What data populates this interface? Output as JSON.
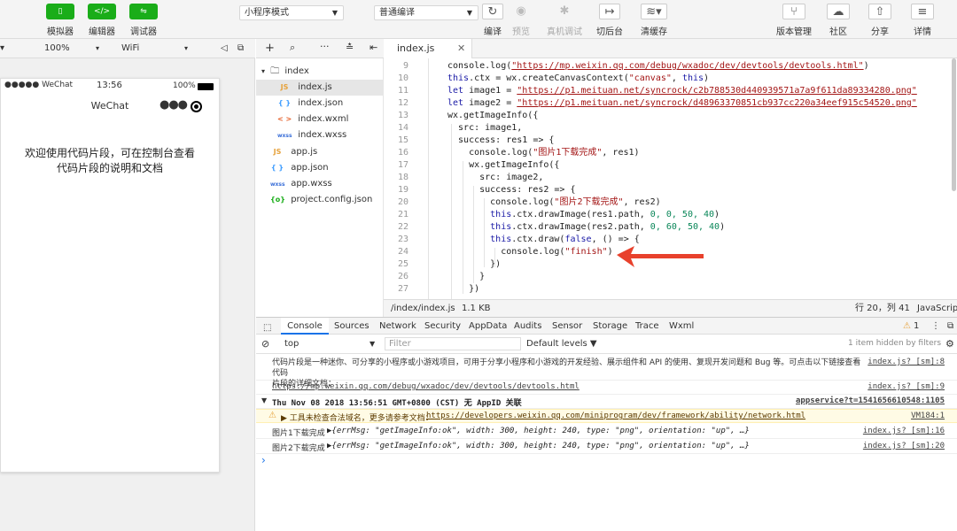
{
  "toolbar": {
    "simulator": "模拟器",
    "editor": "编辑器",
    "debugger": "调试器",
    "mode": "小程序模式",
    "compile": "普通编译",
    "build": "编译",
    "preview": "预览",
    "remote_debug": "真机调试",
    "cut_bg": "切后台",
    "clear_cache": "清缓存",
    "version": "版本管理",
    "community": "社区",
    "share": "分享",
    "details": "详情"
  },
  "devicebar": {
    "zoom": "100%",
    "network": "WiFi"
  },
  "phone": {
    "carrier": "●●●●● WeChat",
    "time": "13:56",
    "battery": "100%",
    "title": "WeChat",
    "text_line1": "欢迎使用代码片段，可在控制台查看",
    "text_line2": "代码片段的说明和文档"
  },
  "tree": {
    "items": [
      "index",
      "index.js",
      "index.json",
      "index.wxml",
      "index.wxss",
      "app.js",
      "app.json",
      "app.wxss",
      "project.config.json"
    ],
    "icons": [
      "▾",
      "JS",
      "{ }",
      "< >",
      "wxss",
      "JS",
      "{ }",
      "wxss",
      "{o}"
    ]
  },
  "editor": {
    "tab": "index.js",
    "line_numbers": [
      "9",
      "10",
      "11",
      "12",
      "13",
      "14",
      "15",
      "16",
      "17",
      "18",
      "19",
      "20",
      "21",
      "22",
      "23",
      "24",
      "25",
      "26",
      "27"
    ],
    "path": "/index/index.js",
    "size": "1.1 KB",
    "cursor": "行 20，列 41",
    "language": "JavaScript",
    "code": {
      "l9a": "console.log(",
      "l9url": "\"https://mp.weixin.qq.com/debug/wxadoc/dev/devtools/devtools.html\"",
      "l9b": ")",
      "l10kw": "this",
      "l10a": ".ctx = wx.createCanvasContext(",
      "l10str": "\"canvas\"",
      "l10b": ", ",
      "l10kw2": "this",
      "l10c": ")",
      "l11kw": "let",
      "l11a": " image1 = ",
      "l11url": "\"https://p1.meituan.net/syncrock/c2b788530d440939571a7a9f611da89334280.png\"",
      "l12kw": "let",
      "l12a": " image2 = ",
      "l12url": "\"https://p1.meituan.net/syncrock/d48963370851cb937cc220a34eef915c54520.png\"",
      "l13": "wx.getImageInfo({",
      "l14": "  src: image1,",
      "l15": "  success: res1 => {",
      "l16a": "    console.log(",
      "l16str": "\"图片1下载完成\"",
      "l16b": ", res1)",
      "l17": "    wx.getImageInfo({",
      "l18": "      src: image2,",
      "l19": "      success: res2 => {",
      "l20a": "        console.log(",
      "l20str": "\"图片2下载完成\"",
      "l20b": ", res2)",
      "l21kw": "        this",
      "l21a": ".ctx.drawImage(res1.path, ",
      "l21n": "0, 0, 50, 40",
      "l21b": ")",
      "l22kw": "        this",
      "l22a": ".ctx.drawImage(res2.path, ",
      "l22n": "0, 60, 50, 40",
      "l22b": ")",
      "l23kw": "        this",
      "l23a": ".ctx.draw(",
      "l23kw2": "false",
      "l23b": ", () => {",
      "l24a": "          console.log(",
      "l24str": "\"finish\"",
      "l24b": ")",
      "l25": "        })",
      "l26": "      }",
      "l27": "    })"
    }
  },
  "devtools": {
    "tabs": [
      "Console",
      "Sources",
      "Network",
      "Security",
      "AppData",
      "Audits",
      "Sensor",
      "Storage",
      "Trace",
      "Wxml"
    ],
    "warn_count": "1",
    "context": "top",
    "filter_placeholder": "Filter",
    "levels": "Default levels ▼",
    "hidden": "1 item hidden by filters",
    "log1_line1": "代码片段是一种迷你、可分享的小程序或小游戏项目，可用于分享小程序和小游戏的开发经验、展示组件和 API 的使用、复现开发问题和 Bug 等。可点击以下链接查看代码",
    "log1_line2": "片段的详细文档：",
    "log1_src": "index.js? [sm]:8",
    "log2_url": "https://mp.weixin.qq.com/debug/wxadoc/dev/devtools/devtools.html",
    "log2_src": "index.js? [sm]:9",
    "log3": "Thu Nov 08 2018 13:56:51 GMT+0800 (CST) 无 AppID 关联",
    "log3_src": "appservice?t=1541656610548:1105",
    "warn_text": "▶ 工具未检查合法域名，更多请参考文档：",
    "warn_url": "https://developers.weixin.qq.com/miniprogram/dev/framework/ability/network.html",
    "warn_src": "VM184:1",
    "log4_label": "图片1下载完成",
    "log4_obj": "▶{errMsg: \"getImageInfo:ok\", width: 300, height: 240, type: \"png\", orientation: \"up\", …}",
    "log4_src": "index.js? [sm]:16",
    "log5_label": "图片2下载完成",
    "log5_obj": "▶{errMsg: \"getImageInfo:ok\", width: 300, height: 240, type: \"png\", orientation: \"up\", …}",
    "log5_src": "index.js? [sm]:20",
    "prompt": "›"
  },
  "colors": {
    "green": "#1aad19",
    "arrow": "#e8412c",
    "warn_bg": "#fffbe5"
  }
}
